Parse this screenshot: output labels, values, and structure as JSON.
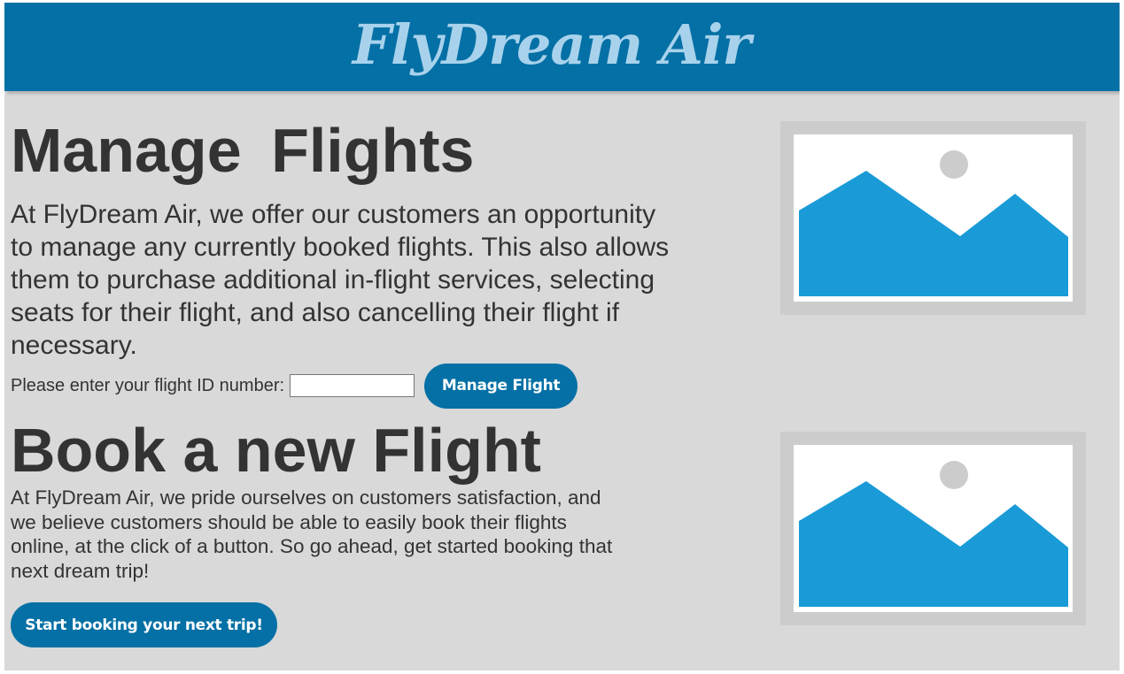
{
  "header": {
    "brand": "FlyDream Air"
  },
  "manage": {
    "title": "Manage  Flights",
    "description": "At FlyDream Air, we offer our customers an opportunity to manage any currently booked flights. This also allows them to purchase additional in-flight services, selecting seats for their flight, and also cancelling their flight if necessary.",
    "id_label": "Please enter your flight ID number:",
    "id_value": "",
    "id_placeholder": "",
    "button_label": "Manage Flight",
    "image_icon": "image-placeholder-icon"
  },
  "book": {
    "title": "Book a new Flight",
    "description": "At FlyDream Air, we pride ourselves on customers satisfaction, and we believe customers should be able to easily book their flights online, at the click of a button. So go ahead, get started booking that next dream trip!",
    "button_label": "Start booking your next trip!",
    "image_icon": "image-placeholder-icon"
  },
  "colors": {
    "brand_blue": "#0470a5",
    "brand_text": "#a8d2ec",
    "page_bg": "#d9d9d9",
    "placeholder_frame": "#cccccc",
    "placeholder_mountain": "#1a9bd7",
    "text": "#333333"
  }
}
